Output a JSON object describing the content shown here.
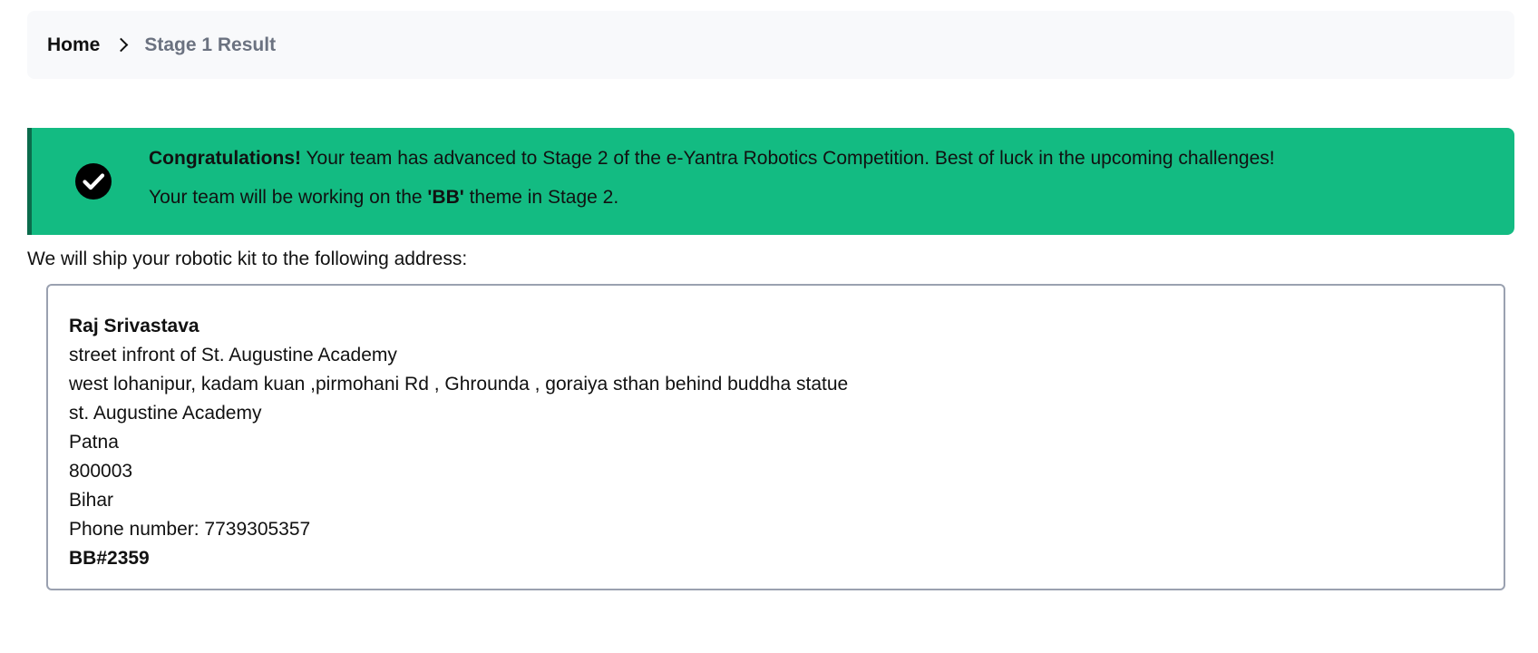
{
  "breadcrumb": {
    "home_label": "Home",
    "separator_icon": "chevron-right-icon",
    "current_label": "Stage 1 Result"
  },
  "alert": {
    "icon": "check-circle-icon",
    "background_color": "#13bb82",
    "border_color": "#0b6b4c",
    "congrats_label": "Congratulations!",
    "message": " Your team has advanced to Stage 2 of the e-Yantra Robotics Competition. Best of luck in the upcoming challenges!",
    "theme_prefix": "Your team will be working on the ",
    "theme_name": "'BB'",
    "theme_suffix": " theme in Stage 2."
  },
  "shipping": {
    "note": "We will ship your robotic kit to the following address:",
    "name": "Raj Srivastava",
    "address_line1": "street infront of St. Augustine Academy",
    "address_line2": "west lohanipur, kadam kuan ,pirmohani Rd , Ghrounda , goraiya sthan behind buddha statue",
    "landmark": "st. Augustine Academy",
    "city": "Patna",
    "pincode": "800003",
    "state": "Bihar",
    "phone": "Phone number: 7739305357",
    "team_id": "BB#2359"
  }
}
